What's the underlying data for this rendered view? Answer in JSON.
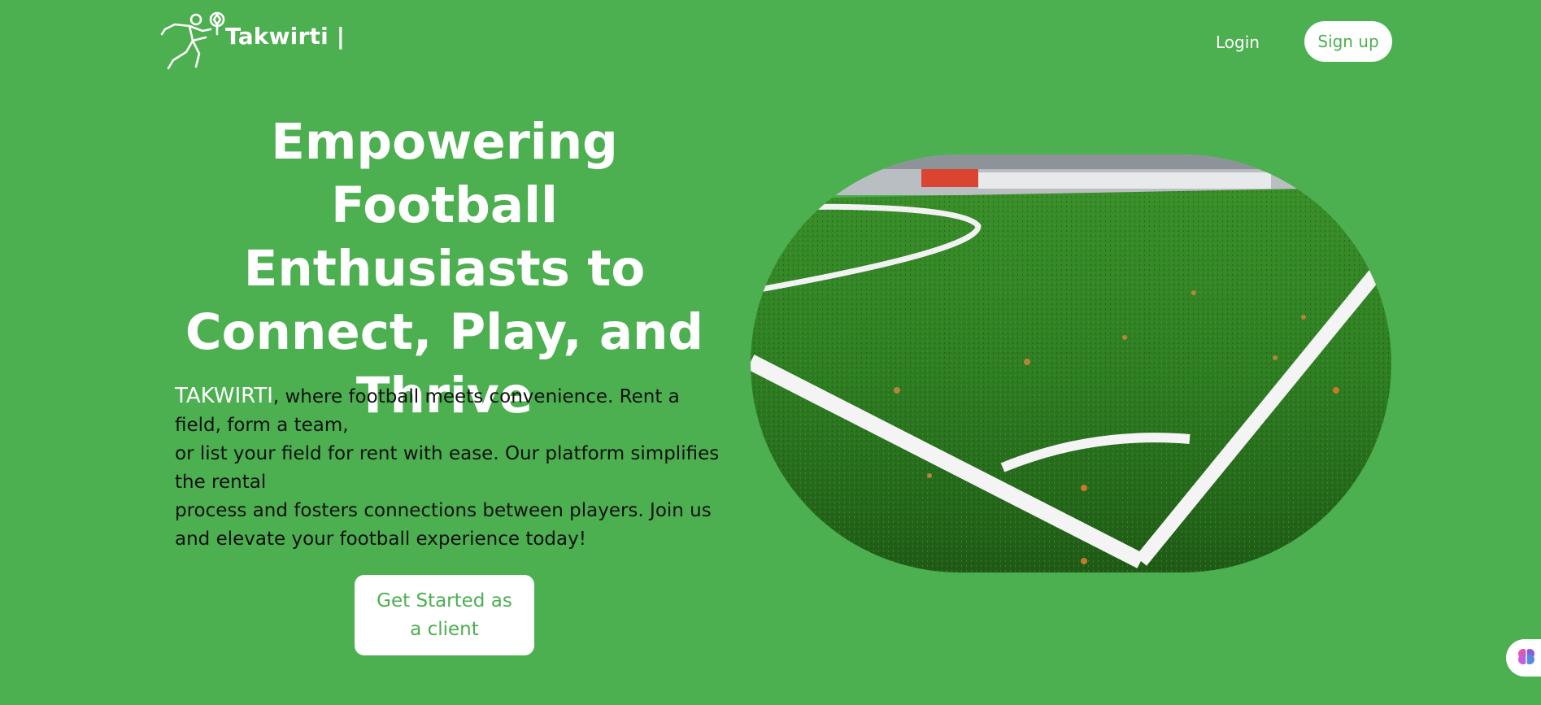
{
  "header": {
    "logo_text": "Takwirti |",
    "logo_icon": "soccer-player-icon",
    "login_label": "Login",
    "signup_label": "Sign up"
  },
  "hero": {
    "headline": "Empowering Football Enthusiasts to Connect, Play, and Thrive",
    "description_brand": "TAKWIRTI",
    "description_line1": ", where football meets convenience. Rent a field, form a team,",
    "description_line2": "or list your field for rent with ease. Our platform simplifies the rental",
    "description_line3": "process and fosters connections between players. Join us and elevate your football experience today!",
    "cta_label": "Get Started as a client"
  },
  "widget": {
    "icon": "brain-icon"
  },
  "colors": {
    "background": "#4caf50",
    "accent": "#4caf50",
    "text_dark": "#111111",
    "white": "#ffffff"
  }
}
